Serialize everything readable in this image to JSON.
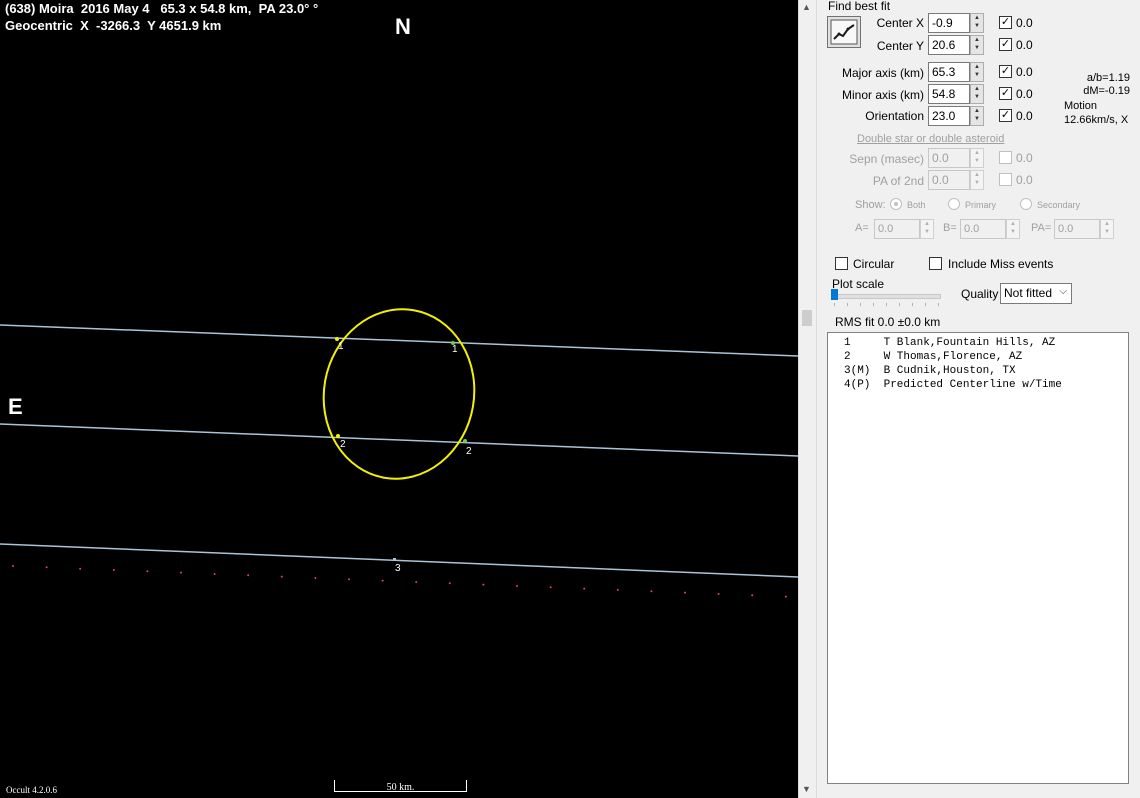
{
  "plot": {
    "header_line1": "(638) Moira  2016 May 4   65.3 x 54.8 km,  PA 23.0° °",
    "header_line2": "Geocentric  X  -3266.3  Y 4651.9 km",
    "north_label": "N",
    "east_label": "E",
    "version": "Occult 4.2.0.6",
    "scale_label": "50 km.",
    "chord_labels": [
      "1",
      "1",
      "2",
      "2",
      "3"
    ],
    "ellipse_color": "#f2f200",
    "chord_color": "#a9c4d8",
    "predicted_dot_color": "#e04848"
  },
  "fit": {
    "title": "Find best fit",
    "rows": [
      {
        "label": "Center X",
        "value": "-0.9",
        "check_value": "0.0"
      },
      {
        "label": "Center Y",
        "value": "20.6",
        "check_value": "0.0"
      },
      {
        "label": "Major axis (km)",
        "value": "65.3",
        "check_value": "0.0"
      },
      {
        "label": "Minor axis (km)",
        "value": "54.8",
        "check_value": "0.0"
      },
      {
        "label": "Orientation",
        "value": "23.0",
        "check_value": "0.0"
      }
    ],
    "ab_ratio": "a/b=1.19",
    "dm": "dM=-0.19",
    "motion_label": "Motion",
    "motion_value": "12.66km/s, X"
  },
  "double": {
    "title": "Double star  or  double asteroid",
    "sepn_label": "Sepn (masec)",
    "sepn_value": "0.0",
    "sepn_check": "0.0",
    "pa2_label": "PA of 2nd",
    "pa2_value": "0.0",
    "pa2_check": "0.0",
    "show_label": "Show:",
    "opt_both": "Both",
    "opt_primary": "Primary",
    "opt_secondary": "Secondary",
    "a_label": "A=",
    "a_value": "0.0",
    "b_label": "B=",
    "b_value": "0.0",
    "pa_label": "PA=",
    "pa_value": "0.0"
  },
  "options": {
    "circular": "Circular",
    "include_miss": "Include Miss events",
    "plot_scale": "Plot scale",
    "quality_label": "Quality",
    "quality_value": "Not fitted",
    "rms": "RMS fit  0.0 ±0.0 km"
  },
  "observers": [
    "1     T Blank,Fountain Hills, AZ",
    "2     W Thomas,Florence, AZ",
    "3(M)  B Cudnik,Houston, TX",
    "4(P)  Predicted Centerline w/Time"
  ]
}
